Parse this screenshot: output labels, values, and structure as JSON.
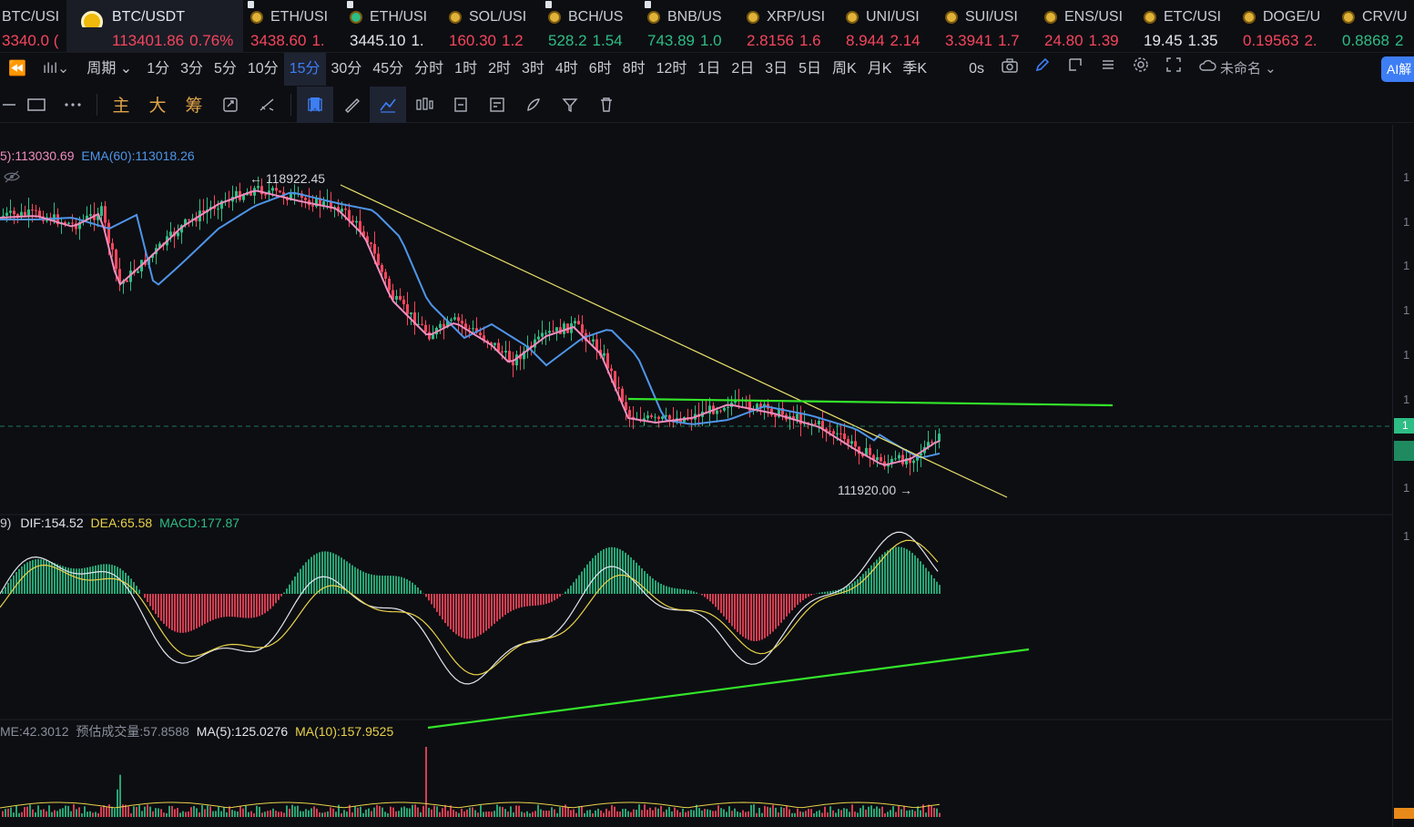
{
  "tickers": [
    {
      "symbol": "BTC/USI",
      "price": "3340.0 (",
      "change": "",
      "dir": "down",
      "first": true
    },
    {
      "symbol": "BTC/USDT",
      "price": "113401.86",
      "change": "0.76%",
      "dir": "down",
      "active": true
    },
    {
      "symbol": "ETH/USI",
      "price": "3438.60",
      "change": "1.",
      "dir": "down"
    },
    {
      "symbol": "ETH/USI",
      "price": "3445.10",
      "change": "1.",
      "dir": "neutral"
    },
    {
      "symbol": "SOL/USI",
      "price": "160.30",
      "change": "1.2",
      "dir": "down"
    },
    {
      "symbol": "BCH/US",
      "price": "528.2",
      "change": "1.54",
      "dir": "up"
    },
    {
      "symbol": "BNB/US",
      "price": "743.89",
      "change": "1.0",
      "dir": "up"
    },
    {
      "symbol": "XRP/USI",
      "price": "2.8156",
      "change": "1.6",
      "dir": "down"
    },
    {
      "symbol": "UNI/USI",
      "price": "8.944",
      "change": "2.14",
      "dir": "down"
    },
    {
      "symbol": "SUI/USI",
      "price": "3.3941",
      "change": "1.7",
      "dir": "down"
    },
    {
      "symbol": "ENS/USI",
      "price": "24.80",
      "change": "1.39",
      "dir": "down"
    },
    {
      "symbol": "ETC/USI",
      "price": "19.45",
      "change": "1.35",
      "dir": "neutral"
    },
    {
      "symbol": "DOGE/U",
      "price": "0.19563",
      "change": "2.",
      "dir": "down"
    },
    {
      "symbol": "CRV/U",
      "price": "0.8868",
      "change": "2",
      "dir": "up"
    }
  ],
  "periods": {
    "back": "⏪",
    "chart_type": "ılıl⌄",
    "period_menu": "周期 ⌄",
    "items": [
      "1分",
      "3分",
      "5分",
      "10分",
      "15分",
      "30分",
      "45分",
      "分时",
      "1时",
      "2时",
      "3时",
      "4时",
      "6时",
      "8时",
      "12时",
      "1日",
      "2日",
      "3日",
      "5日",
      "周K",
      "月K",
      "季K"
    ],
    "active": "15分",
    "countdown": "0s",
    "unnamed_label": "未命名 ⌄",
    "ai_label": "AI解"
  },
  "toolbar": {
    "indicator_main": "主",
    "indicator_big": "大",
    "indicator_chips": "筹"
  },
  "indicators": {
    "main_legend": [
      {
        "text": "5):113030.69",
        "color": "#f08dc0"
      },
      {
        "text": "EMA(60):113018.26",
        "color": "#4f95e8"
      }
    ],
    "high_label": "← 118922.45",
    "low_label": "111920.00 →",
    "macd_legend": [
      {
        "text": "9)",
        "color": "#c9ccd4"
      },
      {
        "text": "DIF:154.52",
        "color": "#e3e6ee"
      },
      {
        "text": "DEA:65.58",
        "color": "#e8d24a"
      },
      {
        "text": "MACD:177.87",
        "color": "#2ebd85"
      }
    ],
    "vol_legend": [
      {
        "text": "ME:42.3012",
        "color": "#8a8f9c"
      },
      {
        "text": "预估成交量:57.8588",
        "color": "#8a8f9c"
      },
      {
        "text": "MA(5):125.0276",
        "color": "#e3e6ee"
      },
      {
        "text": "MA(10):157.9525",
        "color": "#e8d24a"
      }
    ],
    "axis_labels": [
      "1",
      "1",
      "1",
      "1",
      "1",
      "1",
      "1",
      "1"
    ],
    "price_tag": "1"
  },
  "colors": {
    "up": "#2ebd85",
    "down": "#f6465d",
    "ma": "#f08dc0",
    "ema": "#4f95e8",
    "trend_yellow": "#e8e06a",
    "trend_green": "#33e52a",
    "accent": "#3d7ef5"
  }
}
